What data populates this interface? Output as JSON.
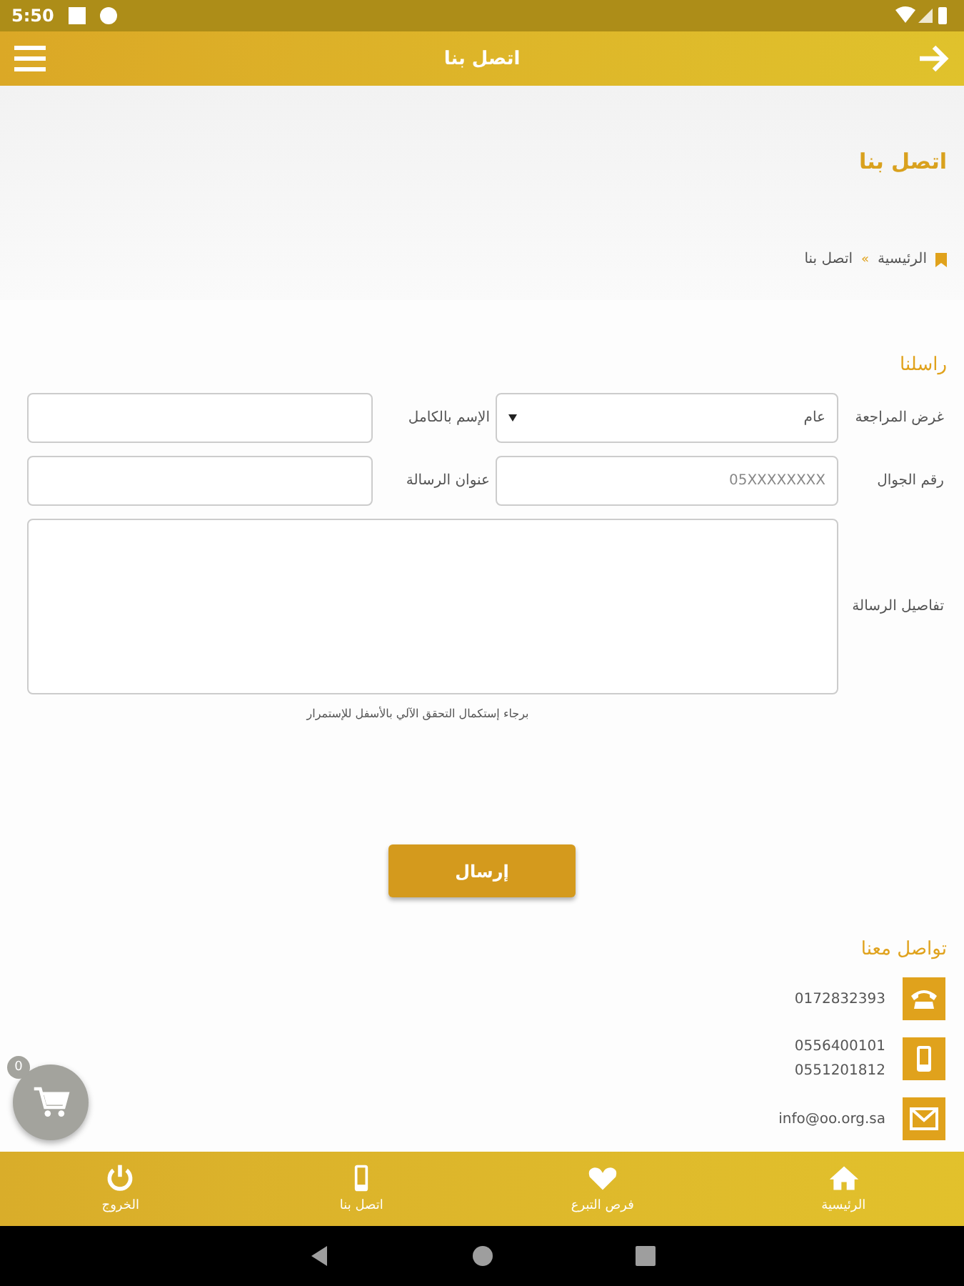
{
  "status_bar": {
    "time": "5:50"
  },
  "app_bar": {
    "title": "اتصل بنا"
  },
  "header": {
    "title": "اتصل بنا",
    "breadcrumb": [
      "الرئيسية",
      "اتصل بنا"
    ],
    "separator": "»"
  },
  "form": {
    "title": "راسلنا",
    "fields": [
      {
        "label": "غرض المراجعة",
        "kind": "select",
        "value": "عام"
      },
      {
        "label": "الإسم بالكامل",
        "kind": "text"
      },
      {
        "label": "رقم الجوال",
        "kind": "text",
        "placeholder": "05XXXXXXXX"
      },
      {
        "label": "عنوان الرسالة",
        "kind": "text"
      },
      {
        "label": "تفاصيل الرسالة",
        "kind": "textarea"
      }
    ],
    "note": "برجاء إستكمال التحقق الآلي بالأسفل للإستمرار",
    "submit": "إرسال"
  },
  "contact": {
    "title": "تواصل معنا",
    "items": [
      {
        "kind": "phone",
        "lines": [
          "0172832393"
        ]
      },
      {
        "kind": "mobile",
        "lines": [
          "0556400101",
          "0551201812"
        ]
      },
      {
        "kind": "email",
        "lines": [
          "info@oo.org.sa"
        ]
      }
    ]
  },
  "cart": {
    "count": "0"
  },
  "bottom_nav": [
    {
      "label": "الرئيسية",
      "kind": "home"
    },
    {
      "label": "فرص التبرع",
      "kind": "heart"
    },
    {
      "label": "اتصل بنا",
      "kind": "mobile"
    },
    {
      "label": "الخروج",
      "kind": "power"
    }
  ]
}
